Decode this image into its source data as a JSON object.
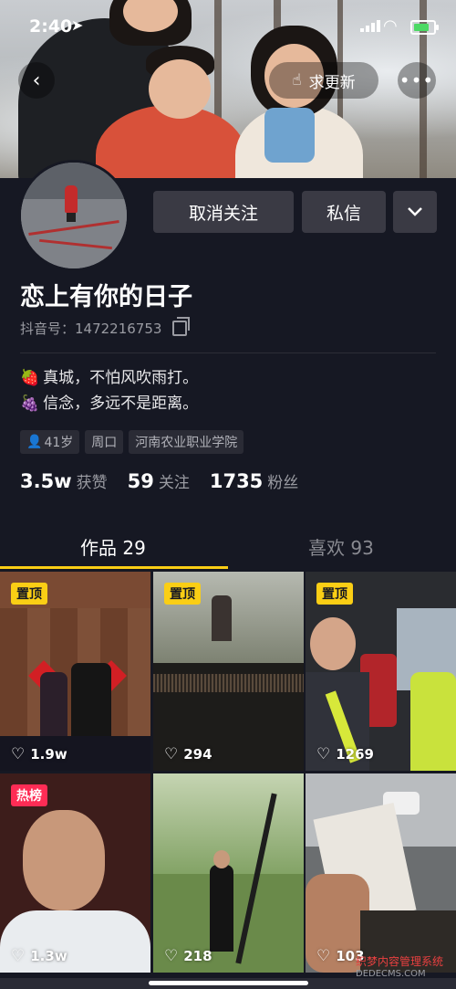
{
  "status_bar": {
    "time": "2:40",
    "location_glyph": "➤"
  },
  "header": {
    "back_icon": "chevron-left-icon",
    "update_button": {
      "icon": "hand-point-icon",
      "label": "求更新"
    },
    "more_icon": "ellipsis-icon"
  },
  "profile": {
    "actions": {
      "unfollow": "取消关注",
      "message": "私信",
      "dropdown_icon": "chevron-down-icon"
    },
    "nickname": "恋上有你的日子",
    "douyin_id_label": "抖音号：1472216753",
    "bio": [
      {
        "emoji": "🍓",
        "text": "真城，不怕风吹雨打。"
      },
      {
        "emoji": "🍇",
        "text": "信念，多远不是距离。"
      }
    ],
    "tags": [
      "41岁",
      "周口",
      "河南农业职业学院"
    ],
    "stats": [
      {
        "num": "3.5w",
        "label": "获赞"
      },
      {
        "num": "59",
        "label": "关注"
      },
      {
        "num": "1735",
        "label": "粉丝"
      }
    ]
  },
  "tabs": {
    "works": "作品 29",
    "likes": "喜欢 93"
  },
  "videos": [
    {
      "badge": "置顶",
      "badge_type": "pin",
      "likes": "1.9w"
    },
    {
      "badge": "置顶",
      "badge_type": "pin",
      "likes": "294"
    },
    {
      "badge": "置顶",
      "badge_type": "pin",
      "likes": "1269"
    },
    {
      "badge": "热榜",
      "badge_type": "hot",
      "likes": "1.3w"
    },
    {
      "badge": "",
      "badge_type": "",
      "likes": "218"
    },
    {
      "badge": "",
      "badge_type": "",
      "likes": "103"
    }
  ],
  "watermark": {
    "line1": "织梦内容管理系统",
    "line2": "DEDECMS.COM"
  },
  "colors": {
    "background": "#161823",
    "accent": "#face15",
    "hot": "#fe2c55",
    "button": "#3a3a44"
  }
}
